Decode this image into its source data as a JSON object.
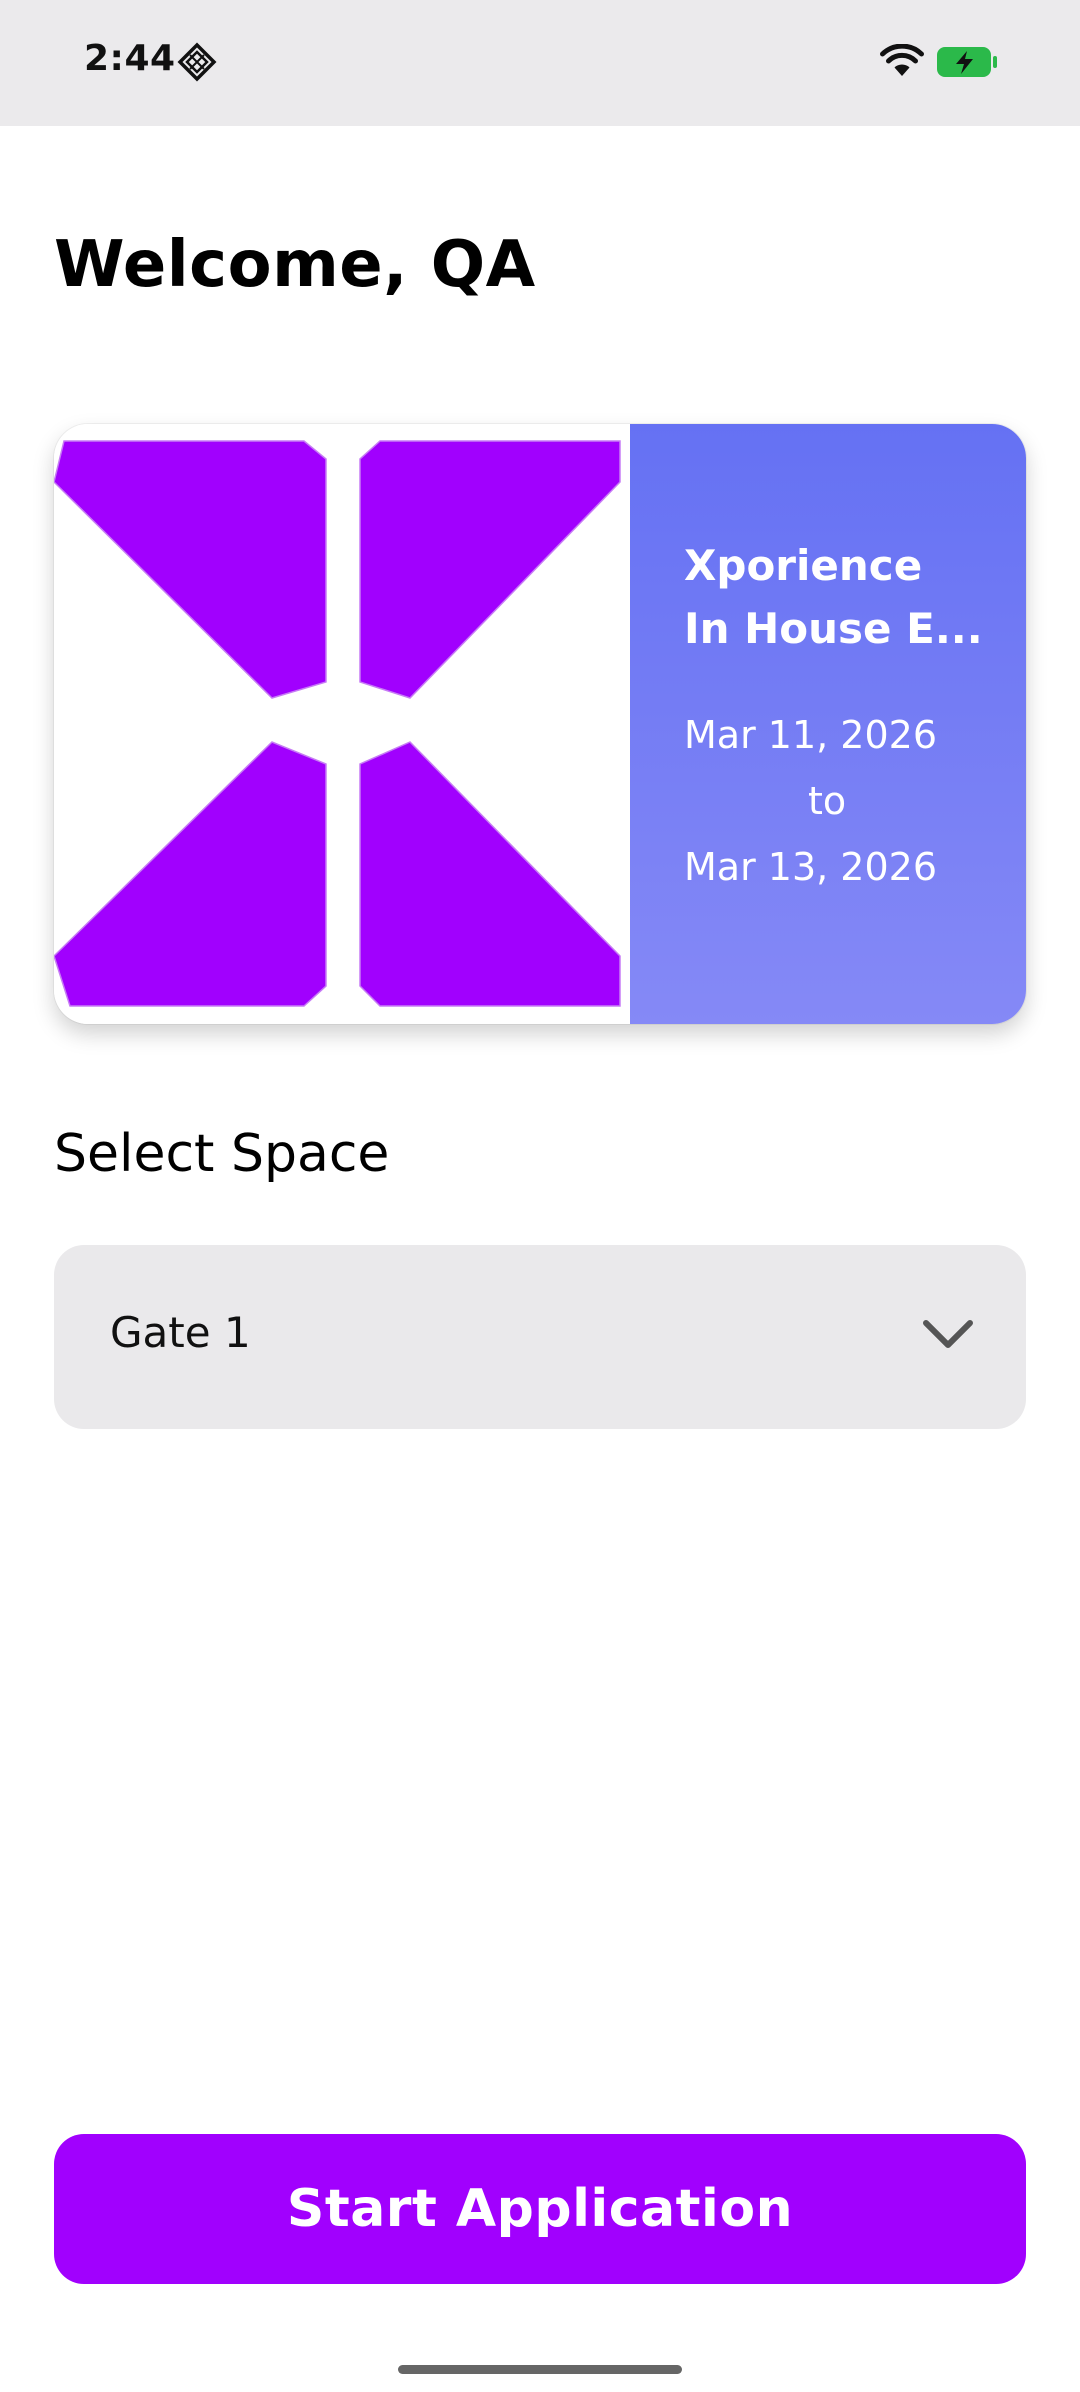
{
  "status_bar": {
    "time": "2:44",
    "icons": [
      "app-gem-icon",
      "wifi-icon",
      "battery-charging-icon"
    ],
    "battery_color": "#2bb94a"
  },
  "header": {
    "welcome": "Welcome, QA"
  },
  "event_card": {
    "title_line_1": "Xporience",
    "title_line_2": "In House E...",
    "start_date": "Mar 11, 2026",
    "date_separator": "to",
    "end_date": "Mar 13, 2026",
    "logo_color": "#a100fe",
    "gradient_top": "#6571f3",
    "gradient_bottom": "#8589f6"
  },
  "space_select": {
    "label": "Select Space",
    "selected_value": "Gate 1"
  },
  "actions": {
    "start_button_label": "Start Application",
    "accent_color": "#a100fe"
  }
}
